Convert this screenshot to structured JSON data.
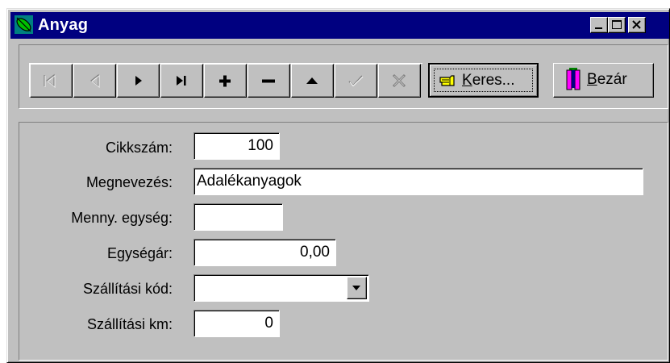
{
  "window": {
    "title": "Anyag",
    "caption_buttons": [
      "minimize",
      "maximize",
      "close"
    ]
  },
  "toolbar": {
    "nav_buttons": [
      {
        "name": "first-record-button",
        "icon": "first-record-icon",
        "enabled": false
      },
      {
        "name": "prior-record-button",
        "icon": "prior-record-icon",
        "enabled": false
      },
      {
        "name": "next-record-button",
        "icon": "next-record-icon",
        "enabled": true
      },
      {
        "name": "last-record-button",
        "icon": "last-record-icon",
        "enabled": true
      },
      {
        "name": "insert-record-button",
        "icon": "plus-icon",
        "enabled": true
      },
      {
        "name": "delete-record-button",
        "icon": "minus-icon",
        "enabled": true
      },
      {
        "name": "edit-record-button",
        "icon": "triangle-up-icon",
        "enabled": true
      },
      {
        "name": "post-record-button",
        "icon": "checkmark-icon",
        "enabled": false
      },
      {
        "name": "cancel-record-button",
        "icon": "cross-icon",
        "enabled": false
      }
    ],
    "search_label_pre": "K",
    "search_label_rest": "eres...",
    "close_label_pre": "B",
    "close_label_rest": "ezár"
  },
  "form": {
    "cikkszam_label": "Cikkszám:",
    "cikkszam_value": "100",
    "megnevezes_label": "Megnevezés:",
    "megnevezes_value": "Adalékanyagok",
    "menny_egyseg_label": "Menny. egység:",
    "menny_egyseg_value": "",
    "egysegar_label": "Egységár:",
    "egysegar_value": "0,00",
    "szallitasi_kod_label": "Szállítási kód:",
    "szallitasi_kod_value": "",
    "szallitasi_km_label": "Szállítási km:",
    "szallitasi_km_value": "0"
  },
  "colors": {
    "titlebar": "#000080",
    "face": "#c0c0c0",
    "disabled": "#808080"
  }
}
